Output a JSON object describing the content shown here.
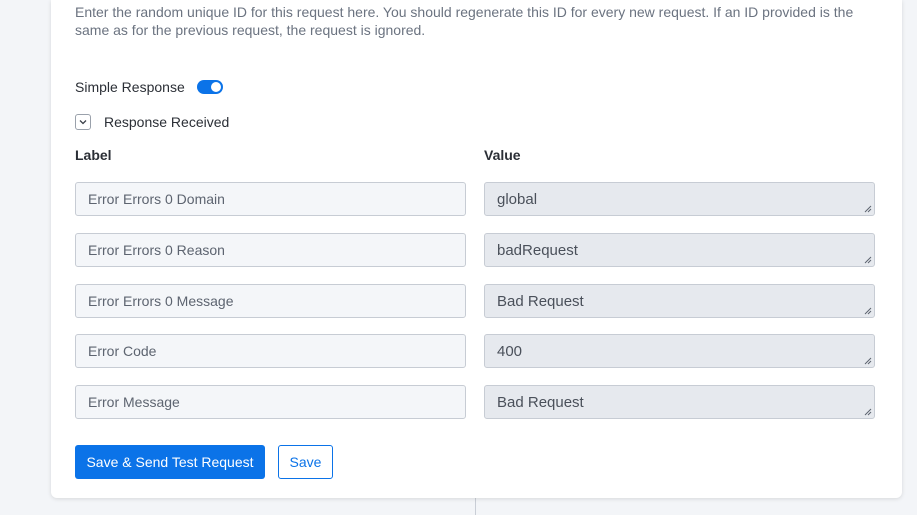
{
  "help_text": "Enter the random unique ID for this request here. You should regenerate this ID for every new request. If an ID provided is the same as for the previous request, the request is ignored.",
  "simple_response": {
    "label": "Simple Response",
    "enabled": true
  },
  "response_received": {
    "label": "Response Received",
    "expanded": true
  },
  "columns": {
    "label": "Label",
    "value": "Value"
  },
  "rows": [
    {
      "label": "Error Errors 0 Domain",
      "value": "global"
    },
    {
      "label": "Error Errors 0 Reason",
      "value": "badRequest"
    },
    {
      "label": "Error Errors 0 Message",
      "value": "Bad Request"
    },
    {
      "label": "Error Code",
      "value": "400"
    },
    {
      "label": "Error Message",
      "value": "Bad Request"
    }
  ],
  "buttons": {
    "save_send": "Save & Send Test Request",
    "save": "Save"
  },
  "colors": {
    "accent": "#0b73e8",
    "label_bg": "#f4f6f9",
    "value_bg": "#e6e9ee"
  }
}
